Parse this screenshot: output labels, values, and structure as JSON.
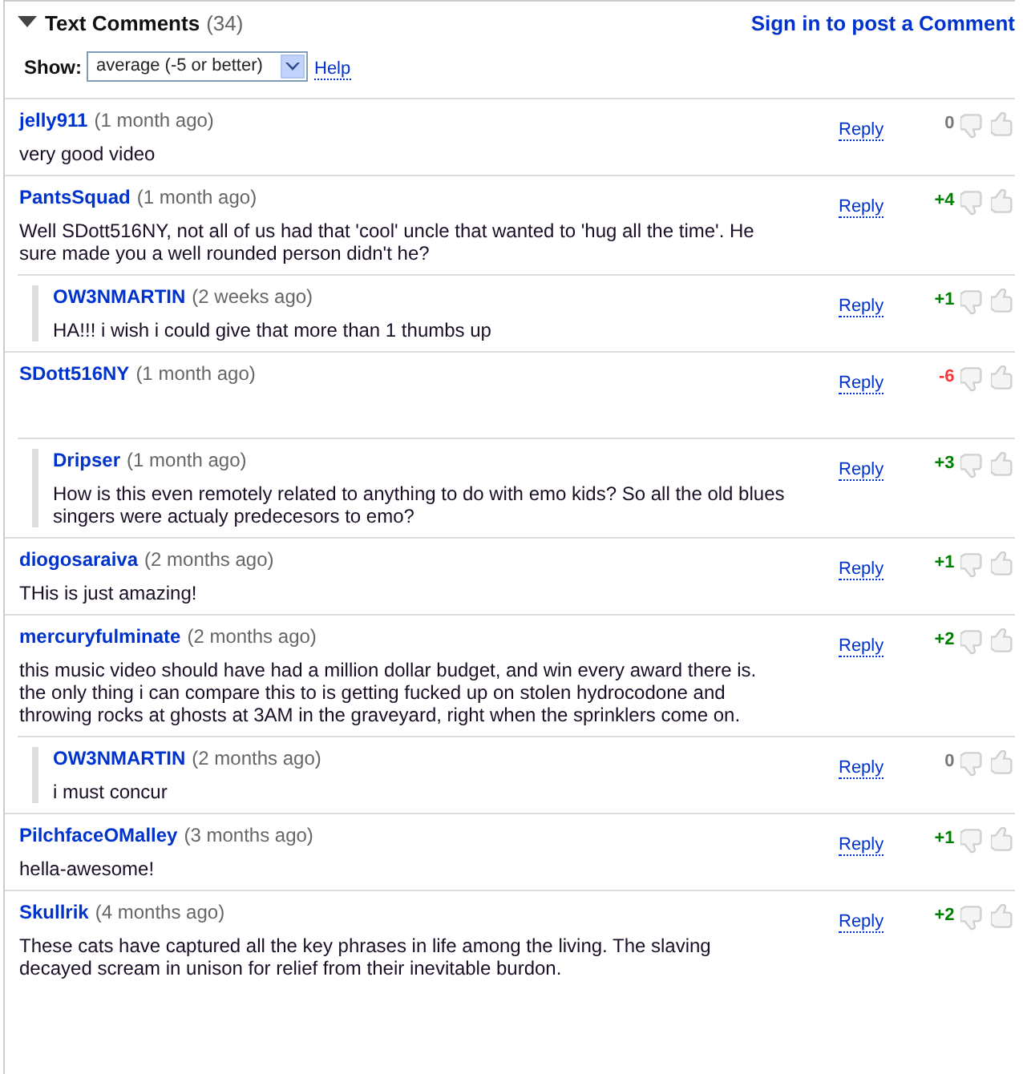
{
  "header": {
    "title": "Text Comments",
    "count": "(34)",
    "expanded": true,
    "sign_in_link": "Sign in to post a Comment"
  },
  "filter": {
    "label": "Show:",
    "value": "average (-5 or better)",
    "help_link": "Help"
  },
  "comments": [
    {
      "author": "jelly911",
      "time": "(1 month ago)",
      "text": "very good video",
      "reply_link": "Reply",
      "score": "0",
      "color": "#777777"
    },
    {
      "author": "PantsSquad",
      "time": "(1 month ago)",
      "text": "Well SDott516NY, not all of us had that 'cool' uncle that wanted to 'hug all the time'. He sure made you a well rounded person didn't he?",
      "reply_link": "Reply",
      "score": "+4",
      "color": "#008000",
      "children": [
        {
          "author": "OW3NMARTIN",
          "time": "(2 weeks ago)",
          "text": "HA!!! i wish i could give that more than 1 thumbs up",
          "reply_link": "Reply",
          "score": "+1",
          "color": "#008000"
        }
      ]
    },
    {
      "author": "SDott516NY",
      "time": "(1 month ago)",
      "reply_link": "Reply",
      "score": "-6",
      "color": "#ff3333",
      "children": [
        {
          "author": "Dripser",
          "time": "(1 month ago)",
          "text": "How is this even remotely related to anything to do with emo kids? So all the old blues singers were actualy predecesors to emo?",
          "reply_link": "Reply",
          "score": "+3",
          "color": "#008000"
        }
      ]
    },
    {
      "author": "diogosaraiva",
      "time": "(2 months ago)",
      "text": "THis is just amazing!",
      "reply_link": "Reply",
      "score": "+1",
      "color": "#008000"
    },
    {
      "author": "mercuryfulminate",
      "time": "(2 months ago)",
      "text": "this music video should have had a million dollar budget, and win every award there is. the only thing i can compare this to is getting fucked up on stolen hydrocodone and throwing rocks at ghosts at 3AM in the graveyard, right when the sprinklers come on.",
      "reply_link": "Reply",
      "score": "+2",
      "color": "#008000",
      "children": [
        {
          "author": "OW3NMARTIN",
          "time": "(2 months ago)",
          "text": "i must concur",
          "reply_link": "Reply",
          "score": "0",
          "color": "#777777"
        }
      ]
    },
    {
      "author": "PilchfaceOMalley",
      "time": "(3 months ago)",
      "text": "hella-awesome!",
      "reply_link": "Reply",
      "score": "+1",
      "color": "#008000"
    },
    {
      "author": "Skullrik",
      "time": "(4 months ago)",
      "text": "These cats have captured all the key phrases in life among the living. The slaving decayed scream in unison for relief from their inevitable burdon.",
      "reply_link": "Reply",
      "score": "+2",
      "color": "#008000"
    }
  ]
}
